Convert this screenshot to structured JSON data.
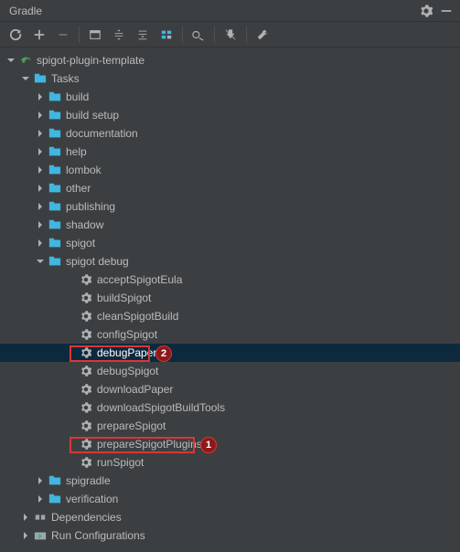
{
  "header": {
    "title": "Gradle"
  },
  "tree": {
    "root": "spigot-plugin-template",
    "tasks_label": "Tasks",
    "folders": [
      "build",
      "build setup",
      "documentation",
      "help",
      "lombok",
      "other",
      "publishing",
      "shadow",
      "spigot"
    ],
    "spigot_debug": {
      "label": "spigot debug",
      "tasks": [
        "acceptSpigotEula",
        "buildSpigot",
        "cleanSpigotBuild",
        "configSpigot",
        "debugPaper",
        "debugSpigot",
        "downloadPaper",
        "downloadSpigotBuildTools",
        "prepareSpigot",
        "prepareSpigotPlugins",
        "runSpigot"
      ],
      "selected": "debugPaper"
    },
    "remaining_folders": [
      "spigradle",
      "verification"
    ],
    "bottom": [
      "Dependencies",
      "Run Configurations"
    ]
  },
  "annotations": {
    "badge1": "1",
    "badge2": "2"
  },
  "colors": {
    "selection": "#0d293e",
    "highlight": "#d93636"
  }
}
